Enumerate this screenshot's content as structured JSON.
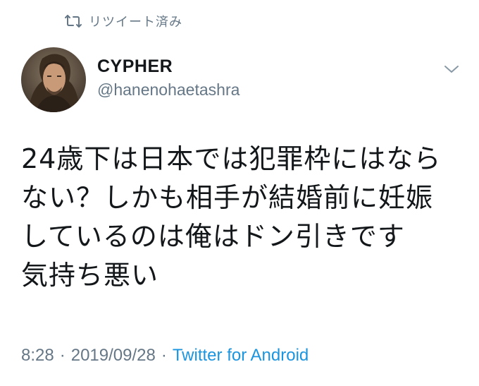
{
  "retweet": {
    "icon": "retweet-icon",
    "label": "リツイート済み"
  },
  "author": {
    "avatar_icon": "avatar",
    "display_name": "CYPHER",
    "username": "@hanenohaetashra"
  },
  "menu": {
    "icon": "chevron-down-icon"
  },
  "tweet": {
    "text": "24歳下は日本では犯罪枠にはなら\nない？しかも相手が結婚前に妊娠\nしているのは俺はドン引きです\n気持ち悪い"
  },
  "meta": {
    "time": "8:28",
    "separator1": "·",
    "date": "2019/09/28",
    "separator2": "·",
    "source": "Twitter for Android"
  },
  "colors": {
    "text": "#14171a",
    "secondary": "#657786",
    "link": "#1b95e0"
  }
}
